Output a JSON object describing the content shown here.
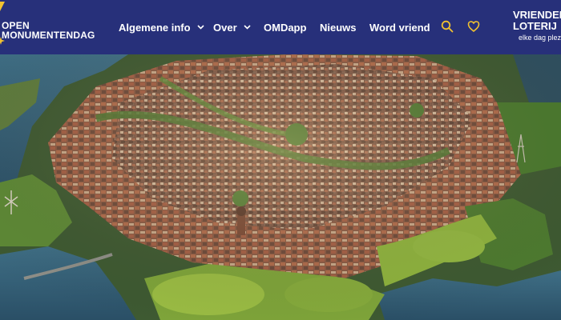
{
  "brand": {
    "line1": "OPEN",
    "line2": "MONUMENTENDAG",
    "mark_color": "#f2c230"
  },
  "nav": {
    "items": [
      {
        "label": "Algemene info",
        "has_dropdown": true
      },
      {
        "label": "Over",
        "has_dropdown": true
      },
      {
        "label": "OMDapp",
        "has_dropdown": false
      },
      {
        "label": "Nieuws",
        "has_dropdown": false
      },
      {
        "label": "Word vriend",
        "has_dropdown": false
      }
    ],
    "search_icon": "search-icon",
    "favorite_icon": "heart-icon"
  },
  "partner": {
    "line1": "VRIENDEN",
    "line2": "LOTERIJ",
    "tagline": "elke dag plezier"
  },
  "colors": {
    "navbar": "#27307a",
    "accent": "#f2c230",
    "text": "#ffffff"
  },
  "hero": {
    "image": "aerial-photo"
  }
}
